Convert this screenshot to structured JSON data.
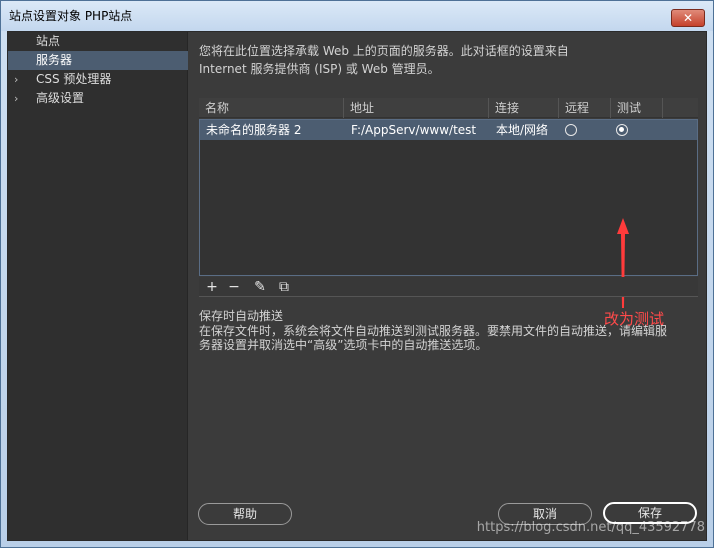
{
  "window": {
    "title": "站点设置对象 PHP站点",
    "close_label": "✕"
  },
  "sidebar": {
    "items": [
      {
        "label": "站点",
        "expandable": false,
        "selected": false
      },
      {
        "label": "服务器",
        "expandable": false,
        "selected": true
      },
      {
        "label": "CSS 预处理器",
        "expandable": true,
        "selected": false
      },
      {
        "label": "高级设置",
        "expandable": true,
        "selected": false
      }
    ],
    "expand_glyph": "›"
  },
  "main": {
    "intro_line1": "您将在此位置选择承载 Web 上的页面的服务器。此对话框的设置来自",
    "intro_line2": "Internet 服务提供商 (ISP) 或 Web 管理员。"
  },
  "server_table": {
    "columns": [
      "名称",
      "地址",
      "连接",
      "远程",
      "测试"
    ],
    "rows": [
      {
        "name": "未命名的服务器 2",
        "address": "F:/AppServ/www/test",
        "connection": "本地/网络",
        "remote_checked": false,
        "test_checked": true
      }
    ]
  },
  "annotation": {
    "text": "改为测试",
    "color": "#ff4a4a"
  },
  "table_toolbar": {
    "add": "+",
    "remove": "−",
    "edit": "✎",
    "duplicate": "⧉"
  },
  "auto_push": {
    "title": "保存时自动推送",
    "body_line1": "在保存文件时，系统会将文件自动推送到测试服务器。要禁用文件的自动推送，请编辑服",
    "body_line2": "务器设置并取消选中“高级”选项卡中的自动推送选项。"
  },
  "buttons": {
    "help": "帮助",
    "cancel": "取消",
    "save": "保存"
  },
  "watermark": "https://blog.csdn.net/qq_43592778"
}
